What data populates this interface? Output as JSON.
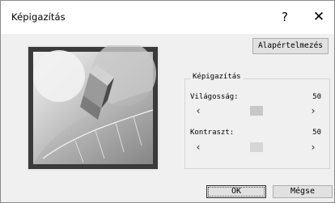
{
  "window": {
    "title": "Képigazítás",
    "help_label": "?",
    "close_label": "✕"
  },
  "buttons": {
    "defaults_label": "Alapértelmezés",
    "ok_label": "OK",
    "cancel_label": "Mégse"
  },
  "group": {
    "label": "Képigazítás",
    "brightness": {
      "label": "Világosság:",
      "value": "50",
      "left_arrow": "‹",
      "right_arrow": "›"
    },
    "contrast": {
      "label": "Kontraszt:",
      "value": "50",
      "left_arrow": "‹",
      "right_arrow": "›"
    }
  }
}
